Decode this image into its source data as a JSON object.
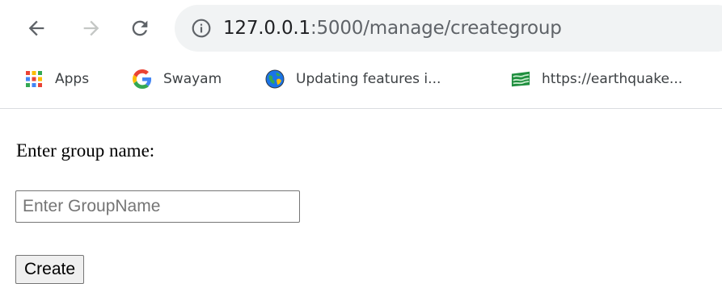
{
  "browser": {
    "nav": {
      "back_icon": "arrow-left-icon",
      "forward_icon": "arrow-right-icon",
      "reload_icon": "reload-icon"
    },
    "address_bar": {
      "info_icon": "info-circle-icon",
      "host": "127.0.0.1",
      "rest": ":5000/manage/creategroup"
    },
    "bookmarks": [
      {
        "label": "Apps",
        "icon": "apps-grid-icon"
      },
      {
        "label": "Swayam",
        "icon": "google-g-icon"
      },
      {
        "label": "Updating features i...",
        "icon": "globe-icon"
      },
      {
        "label": "https://earthquake...",
        "icon": "map-icon"
      }
    ]
  },
  "page": {
    "label": "Enter group name:",
    "input": {
      "value": "",
      "placeholder": "Enter GroupName"
    },
    "create_button_label": "Create"
  },
  "colors": {
    "omnibox_bg": "#f1f3f4",
    "divider": "#dadce0",
    "button_bg": "#efefef"
  }
}
